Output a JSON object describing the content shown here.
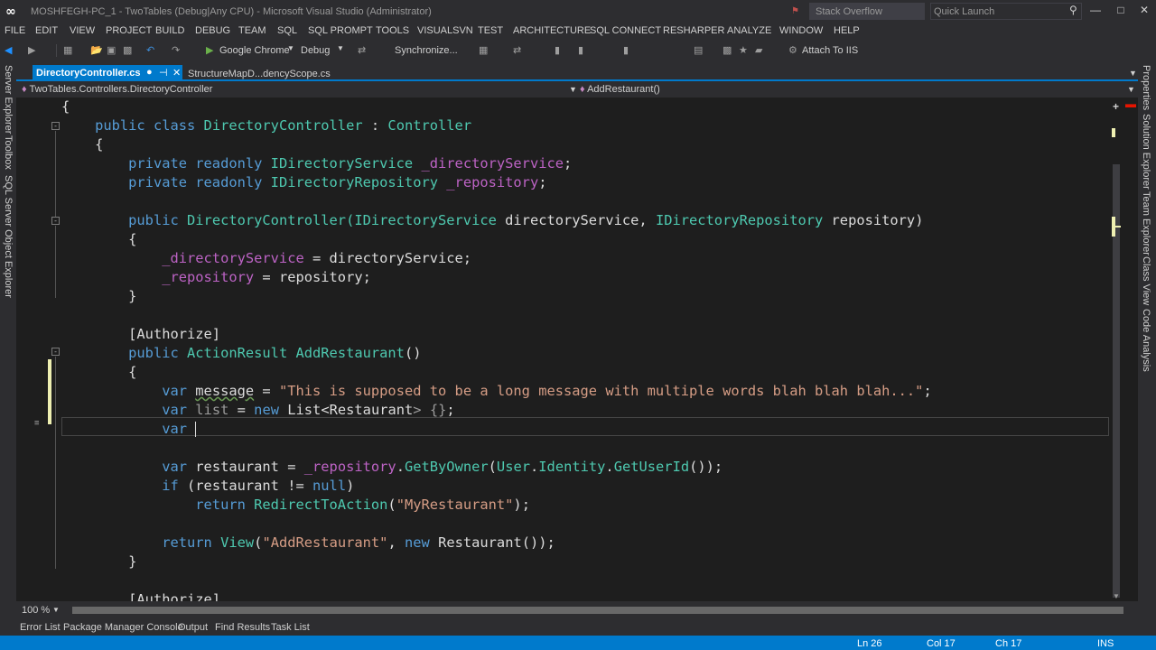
{
  "titlebar": {
    "title": "MOSHFEGH-PC_1 - TwoTables (Debug|Any CPU) - Microsoft Visual Studio (Administrator)",
    "stack_overflow": "Stack Overflow",
    "quick_launch": "Quick Launch"
  },
  "menu": [
    "FILE",
    "EDIT",
    "VIEW",
    "PROJECT",
    "BUILD",
    "DEBUG",
    "TEAM",
    "SQL",
    "SQL PROMPT",
    "TOOLS",
    "VISUALSVN",
    "TEST",
    "ARCHITECTURE",
    "SQL CONNECT",
    "RESHARPER",
    "ANALYZE",
    "WINDOW",
    "HELP"
  ],
  "toolbar": {
    "browser": "Google Chrome",
    "config": "Debug",
    "synchronize": "Synchronize...",
    "attach": "Attach To IIS"
  },
  "left_sidebar": [
    "Server Explorer",
    "Toolbox",
    "SQL Server Object Explorer"
  ],
  "right_sidebar": [
    "Properties",
    "Solution Explorer",
    "Team Explorer",
    "Class View",
    "Code Analysis"
  ],
  "tabs": {
    "active": "DirectoryController.cs",
    "active_modified": "●",
    "second": "StructureMapD...dencyScope.cs"
  },
  "navbar": {
    "class_path": "TwoTables.Controllers.DirectoryController",
    "member": "AddRestaurant()"
  },
  "code": {
    "l1": "{",
    "l2_kw": "public class ",
    "l2_name": "DirectoryController",
    "l2_sep": " : ",
    "l2_base": "Controller",
    "l3": "{",
    "l4_kw": "private readonly ",
    "l4_type": "IDirectoryService",
    "l4_field": "_directoryService",
    "l5_kw": "private readonly ",
    "l5_type": "IDirectoryRepository",
    "l5_field": "_repository",
    "l7_kw": "public ",
    "l7_name": "DirectoryController(",
    "l7_t1": "IDirectoryService",
    "l7_p1": " directoryService, ",
    "l7_t2": "IDirectoryRepository",
    "l7_p2": " repository)",
    "l8": "{",
    "l9_field": "_directoryService",
    "l9_rest": " = directoryService;",
    "l10_field": "_repository",
    "l10_rest": " = repository;",
    "l11": "}",
    "l13": "[Authorize]",
    "l14_kw": "public ",
    "l14_type": "ActionResult",
    "l14_name": " AddRestaurant",
    "l14_rest": "()",
    "l15": "{",
    "l16_kw": "var ",
    "l16_name": "message",
    "l16_eq": " = ",
    "l16_str": "\"This is supposed to be a long message with multiple words blah blah blah...\"",
    "l16_end": ";",
    "l17_kw": "var ",
    "l17_name": "list",
    "l17_eq": " = ",
    "l17_new": "new ",
    "l17_type": "List",
    "l17_lt": "<",
    "l17_arg": "Restaurant",
    "l17_gt": "> {}",
    "l17_end": ";",
    "l18_kw": "var ",
    "l20_kw": "var ",
    "l20_a": "restaurant = ",
    "l20_field": "_repository",
    "l20_dot": ".",
    "l20_m1": "GetByOwner",
    "l20_b": "(",
    "l20_user": "User",
    "l20_d2": ".",
    "l20_ident": "Identity",
    "l20_d3": ".",
    "l20_m2": "GetUserId",
    "l20_end": "());",
    "l21_kw": "if ",
    "l21_a": "(restaurant != ",
    "l21_null": "null",
    "l21_end": ")",
    "l22_kw": "return ",
    "l22_m": "RedirectToAction",
    "l22_a": "(",
    "l22_str": "\"MyRestaurant\"",
    "l22_end": ");",
    "l24_kw": "return ",
    "l24_m": "View",
    "l24_a": "(",
    "l24_str": "\"AddRestaurant\"",
    "l24_b": ", ",
    "l24_new": "new ",
    "l24_type": "Restaurant",
    "l24_end": "());",
    "l25": "}",
    "l27": "[Authorize]"
  },
  "zoom": "100 %",
  "bottom_tabs": [
    "Error List",
    "Package Manager Console",
    "Output",
    "Find Results",
    "Task List"
  ],
  "status": {
    "ln": "Ln 26",
    "col": "Col 17",
    "ch": "Ch 17",
    "mode": "INS"
  },
  "colors": {
    "accent": "#007acc",
    "keyword": "#569cd6",
    "type": "#4ec9b0",
    "field": "#bd63c5",
    "string": "#d69d85"
  }
}
